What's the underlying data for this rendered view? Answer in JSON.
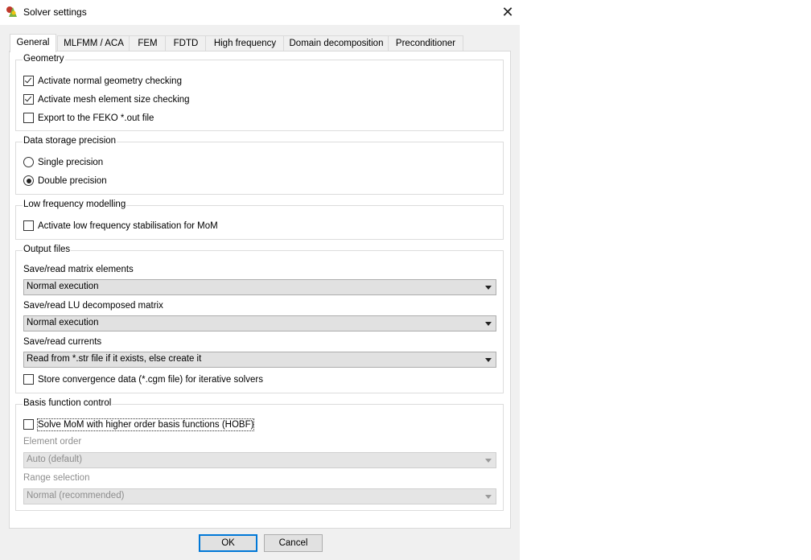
{
  "window": {
    "title": "Solver settings",
    "close_glyph": "✕"
  },
  "tabs": [
    {
      "label": "General",
      "active": true
    },
    {
      "label": "MLFMM / ACA"
    },
    {
      "label": "FEM"
    },
    {
      "label": "FDTD"
    },
    {
      "label": "High frequency"
    },
    {
      "label": "Domain decomposition"
    },
    {
      "label": "Preconditioner"
    }
  ],
  "geometry": {
    "legend": "Geometry",
    "normal_check": {
      "label": "Activate normal geometry checking",
      "checked": true
    },
    "mesh_check": {
      "label": "Activate mesh element size checking",
      "checked": true
    },
    "export_out": {
      "label": "Export to the FEKO *.out file",
      "checked": false
    }
  },
  "precision": {
    "legend": "Data storage precision",
    "single": {
      "label": "Single precision",
      "selected": false
    },
    "double": {
      "label": "Double precision",
      "selected": true
    }
  },
  "lowfreq": {
    "legend": "Low frequency modelling",
    "stabilisation": {
      "label": "Activate low frequency stabilisation for MoM",
      "checked": false
    }
  },
  "output": {
    "legend": "Output files",
    "matrix_label": "Save/read matrix elements",
    "matrix_value": "Normal execution",
    "lu_label": "Save/read LU decomposed matrix",
    "lu_value": "Normal execution",
    "currents_label": "Save/read currents",
    "currents_value": "Read from *.str file if it exists, else create it",
    "convergence": {
      "label": "Store convergence data (*.cgm file) for iterative solvers",
      "checked": false
    }
  },
  "basis": {
    "legend": "Basis function control",
    "hobf": {
      "label": "Solve MoM with higher order basis functions (HOBF)",
      "checked": false
    },
    "element_order_label": "Element order",
    "element_order_value": "Auto (default)",
    "range_label": "Range selection",
    "range_value": "Normal (recommended)"
  },
  "buttons": {
    "ok": "OK",
    "cancel": "Cancel"
  },
  "colors": {
    "accent": "#0078d7",
    "dialog_bg": "#f0f0f0",
    "panel_bg": "#ffffff"
  },
  "icons": {
    "app": "feko-app-icon",
    "close": "close-icon",
    "dropdown": "chevron-down-icon"
  }
}
